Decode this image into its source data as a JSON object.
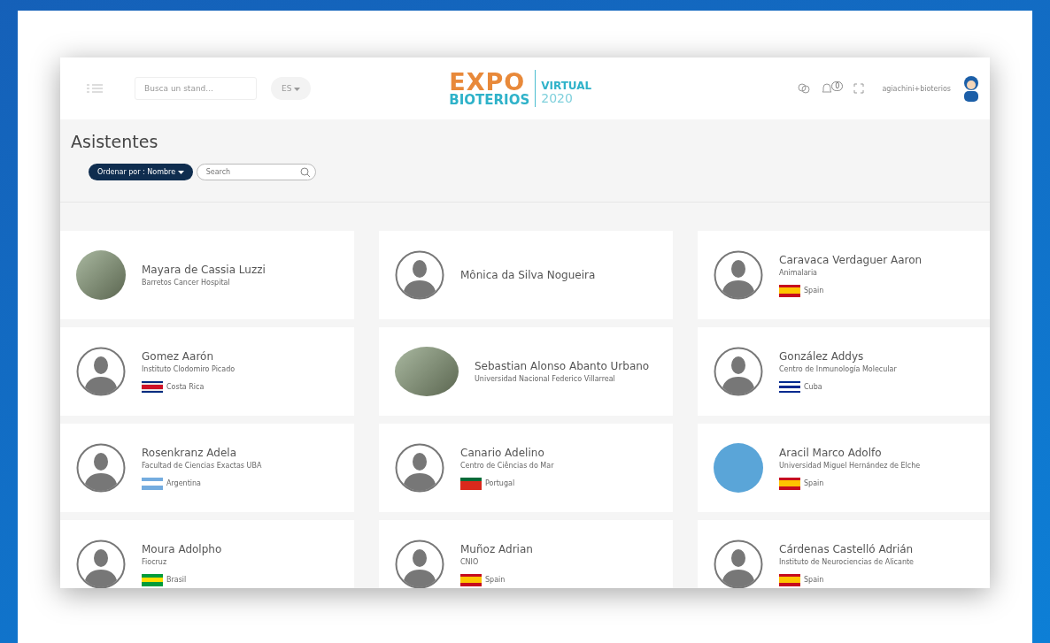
{
  "header": {
    "search": {
      "placeholder": "Busca un stand..."
    },
    "language": "ES",
    "logo": {
      "line_1": "EXPO",
      "line_2": "BIOTERIOS",
      "side_1": "VIRTUAL",
      "side_2": "2020"
    },
    "notifications": "0",
    "user": "agiachini+bioterios"
  },
  "page": {
    "title": "Asistentes",
    "sort_button": "Ordenar por : Nombre",
    "search": {
      "placeholder": "Search"
    }
  },
  "attendees": [
    {
      "name": "Mayara de Cassia Luzzi",
      "org": "Barretos Cancer Hospital",
      "avatar": {
        "kind": "photo"
      }
    },
    {
      "name": "Mônica da Silva Nogueira",
      "avatar": {
        "kind": "default"
      }
    },
    {
      "name": "Caravaca Verdaguer Aaron",
      "org": "Animalaria",
      "country": "Spain",
      "flag_stripes": [
        {
          "color": "#c60b1e"
        },
        {
          "color": "#ffc400"
        },
        {
          "color": "#ffc400"
        },
        {
          "color": "#c60b1e"
        }
      ],
      "avatar": {
        "kind": "default"
      }
    },
    {
      "name": "Gomez Aarón",
      "org": "Instituto Clodomiro Picado",
      "country": "Costa Rica",
      "flag_stripes": [
        {
          "color": "#002b7f"
        },
        {
          "color": "#e8e8e8"
        },
        {
          "color": "#ce1126"
        },
        {
          "color": "#ce1126"
        },
        {
          "color": "#e8e8e8"
        },
        {
          "color": "#002b7f"
        }
      ],
      "avatar": {
        "kind": "default"
      }
    },
    {
      "name": "Sebastian Alonso Abanto Urbano",
      "org": "Universidad Nacional Federico Villarreal",
      "avatar": {
        "kind": "photo"
      }
    },
    {
      "name": "González Addys",
      "org": "Centro de Inmunología Molecular",
      "country": "Cuba",
      "flag_stripes": [
        {
          "color": "#002a8f"
        },
        {
          "color": "#ffffff"
        },
        {
          "color": "#002a8f"
        },
        {
          "color": "#ffffff"
        },
        {
          "color": "#002a8f"
        }
      ],
      "avatar": {
        "kind": "default"
      }
    },
    {
      "name": "Rosenkranz Adela",
      "org": "Facultad de Ciencias Exactas UBA",
      "country": "Argentina",
      "flag_stripes": [
        {
          "color": "#74acdf"
        },
        {
          "color": "#ffffff"
        },
        {
          "color": "#74acdf"
        }
      ],
      "avatar": {
        "kind": "default"
      }
    },
    {
      "name": "Canario Adelino",
      "org": "Centro de Ciências do Mar",
      "country": "Portugal",
      "flag_stripes": [
        {
          "color": "#046a38"
        },
        {
          "color": "#da291c"
        },
        {
          "color": "#da291c"
        }
      ],
      "avatar": {
        "kind": "default"
      }
    },
    {
      "name": "Aracil Marco Adolfo",
      "org": "Universidad Miguel Hernández de Elche",
      "country": "Spain",
      "flag_stripes": [
        {
          "color": "#c60b1e"
        },
        {
          "color": "#ffc400"
        },
        {
          "color": "#ffc400"
        },
        {
          "color": "#c60b1e"
        }
      ],
      "avatar": {
        "kind": "cartoon"
      }
    },
    {
      "name": "Moura Adolpho",
      "org": "Fiocruz",
      "country": "Brasil",
      "flag_stripes": [
        {
          "color": "#009c3b"
        },
        {
          "color": "#ffdf00"
        },
        {
          "color": "#009c3b"
        }
      ],
      "avatar": {
        "kind": "default"
      }
    },
    {
      "name": "Muñoz Adrian",
      "org": "CNIO",
      "country": "Spain",
      "flag_stripes": [
        {
          "color": "#c60b1e"
        },
        {
          "color": "#ffc400"
        },
        {
          "color": "#ffc400"
        },
        {
          "color": "#c60b1e"
        }
      ],
      "avatar": {
        "kind": "default"
      }
    },
    {
      "name": "Cárdenas Castelló Adrián",
      "org": "Instituto de Neurociencias de Alicante",
      "country": "Spain",
      "flag_stripes": [
        {
          "color": "#c60b1e"
        },
        {
          "color": "#ffc400"
        },
        {
          "color": "#ffc400"
        },
        {
          "color": "#c60b1e"
        }
      ],
      "avatar": {
        "kind": "default"
      }
    }
  ]
}
